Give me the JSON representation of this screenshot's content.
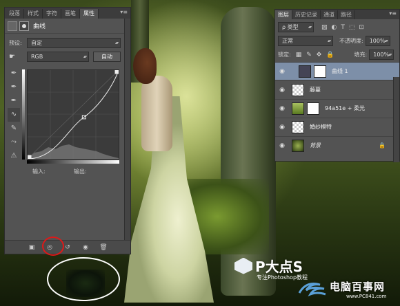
{
  "props_panel": {
    "tabs": [
      "段落",
      "样式",
      "字符",
      "画笔",
      "属性"
    ],
    "active_tab": "属性",
    "title": "曲线",
    "preset_label": "预设:",
    "preset_value": "自定",
    "channel_value": "RGB",
    "auto_label": "自动",
    "input_label": "输入:",
    "output_label": "输出:"
  },
  "layers_panel": {
    "tabs": [
      "图层",
      "历史记录",
      "通道",
      "路径"
    ],
    "active_tab": "图层",
    "filter_type": "类型",
    "blend_mode": "正常",
    "opacity_label": "不透明度:",
    "opacity_value": "100%",
    "lock_label": "锁定:",
    "fill_label": "填充:",
    "fill_value": "100%",
    "layers": [
      {
        "name": "曲线 1",
        "selected": true
      },
      {
        "name": "藤蔓",
        "selected": false
      },
      {
        "name": "94a51e + 柔光",
        "selected": false
      },
      {
        "name": "婚纱模特",
        "selected": false
      },
      {
        "name": "背景",
        "selected": false
      }
    ]
  },
  "watermark": {
    "brand": "P大点S",
    "subtitle": "专注Photoshop教程",
    "site_name": "电脑百事网",
    "site_url": "www.PC841.com"
  },
  "curve_points": [
    [
      0,
      0
    ],
    [
      0.62,
      0.47
    ],
    [
      1,
      1
    ]
  ],
  "colors": {
    "panel": "#535353",
    "selected_layer": "#7d8fa8",
    "highlight_circle": "#e01818"
  }
}
